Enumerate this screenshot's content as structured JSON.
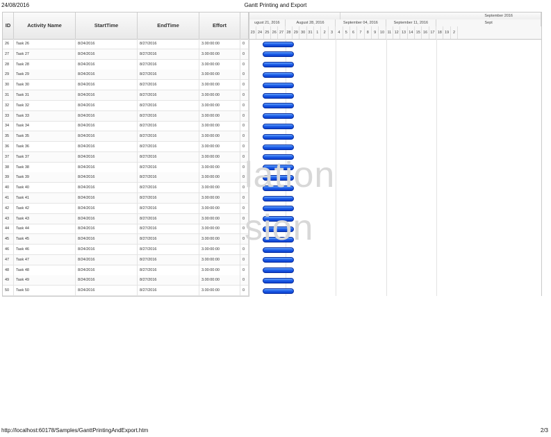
{
  "page": {
    "date": "24/08/2016",
    "title": "Gantt Printing and Export",
    "url": "http://localhost:60178/Samples/GanttPrintingAndExport.htm",
    "page_num": "2/3"
  },
  "grid": {
    "columns": [
      "ID",
      "Activity Name",
      "StartTime",
      "EndTime",
      "Effort",
      ""
    ],
    "rows": [
      {
        "id": "26",
        "name": "Task 26",
        "start": "8/24/2016",
        "end": "8/27/2016",
        "effort": "3.00:00:00",
        "x": "0"
      },
      {
        "id": "27",
        "name": "Task 27",
        "start": "8/24/2016",
        "end": "8/27/2016",
        "effort": "3.00:00:00",
        "x": "0"
      },
      {
        "id": "28",
        "name": "Task 28",
        "start": "8/24/2016",
        "end": "8/27/2016",
        "effort": "3.00:00:00",
        "x": "0"
      },
      {
        "id": "29",
        "name": "Task 29",
        "start": "8/24/2016",
        "end": "8/27/2016",
        "effort": "3.00:00:00",
        "x": "0"
      },
      {
        "id": "30",
        "name": "Task 30",
        "start": "8/24/2016",
        "end": "8/27/2016",
        "effort": "3.00:00:00",
        "x": "0"
      },
      {
        "id": "31",
        "name": "Task 31",
        "start": "8/24/2016",
        "end": "8/27/2016",
        "effort": "3.00:00:00",
        "x": "0"
      },
      {
        "id": "32",
        "name": "Task 32",
        "start": "8/24/2016",
        "end": "8/27/2016",
        "effort": "3.00:00:00",
        "x": "0"
      },
      {
        "id": "33",
        "name": "Task 33",
        "start": "8/24/2016",
        "end": "8/27/2016",
        "effort": "3.00:00:00",
        "x": "0"
      },
      {
        "id": "34",
        "name": "Task 34",
        "start": "8/24/2016",
        "end": "8/27/2016",
        "effort": "3.00:00:00",
        "x": "0"
      },
      {
        "id": "35",
        "name": "Task 35",
        "start": "8/24/2016",
        "end": "8/27/2016",
        "effort": "3.00:00:00",
        "x": "0"
      },
      {
        "id": "36",
        "name": "Task 36",
        "start": "8/24/2016",
        "end": "8/27/2016",
        "effort": "3.00:00:00",
        "x": "0"
      },
      {
        "id": "37",
        "name": "Task 37",
        "start": "8/24/2016",
        "end": "8/27/2016",
        "effort": "3.00:00:00",
        "x": "0"
      },
      {
        "id": "38",
        "name": "Task 38",
        "start": "8/24/2016",
        "end": "8/27/2016",
        "effort": "3.00:00:00",
        "x": "0"
      },
      {
        "id": "39",
        "name": "Task 39",
        "start": "8/24/2016",
        "end": "8/27/2016",
        "effort": "3.00:00:00",
        "x": "0"
      },
      {
        "id": "40",
        "name": "Task 40",
        "start": "8/24/2016",
        "end": "8/27/2016",
        "effort": "3.00:00:00",
        "x": "0"
      },
      {
        "id": "41",
        "name": "Task 41",
        "start": "8/24/2016",
        "end": "8/27/2016",
        "effort": "3.00:00:00",
        "x": "0"
      },
      {
        "id": "42",
        "name": "Task 42",
        "start": "8/24/2016",
        "end": "8/27/2016",
        "effort": "3.00:00:00",
        "x": "0"
      },
      {
        "id": "43",
        "name": "Task 43",
        "start": "8/24/2016",
        "end": "8/27/2016",
        "effort": "3.00:00:00",
        "x": "0"
      },
      {
        "id": "44",
        "name": "Task 44",
        "start": "8/24/2016",
        "end": "8/27/2016",
        "effort": "3.00:00:00",
        "x": "0"
      },
      {
        "id": "45",
        "name": "Task 45",
        "start": "8/24/2016",
        "end": "8/27/2016",
        "effort": "3.00:00:00",
        "x": "0"
      },
      {
        "id": "46",
        "name": "Task 46",
        "start": "8/24/2016",
        "end": "8/27/2016",
        "effort": "3.00:00:00",
        "x": "0"
      },
      {
        "id": "47",
        "name": "Task 47",
        "start": "8/24/2016",
        "end": "8/27/2016",
        "effort": "3.00:00:00",
        "x": "0"
      },
      {
        "id": "48",
        "name": "Task 48",
        "start": "8/24/2016",
        "end": "8/27/2016",
        "effort": "3.00:00:00",
        "x": "0"
      },
      {
        "id": "49",
        "name": "Task 49",
        "start": "8/24/2016",
        "end": "8/27/2016",
        "effort": "3.00:00:00",
        "x": "0"
      },
      {
        "id": "50",
        "name": "Task 50",
        "start": "8/24/2016",
        "end": "8/27/2016",
        "effort": "3.00:00:00",
        "x": "0"
      }
    ]
  },
  "timeline": {
    "month_label": "September 2016",
    "weeks": [
      "ugust 21, 2016",
      "August 28, 2016",
      "September 04, 2016",
      "September 11, 2016",
      "Sept"
    ],
    "days": [
      "23",
      "24",
      "25",
      "26",
      "27",
      "28",
      "29",
      "30",
      "31",
      "1",
      "2",
      "3",
      "4",
      "5",
      "6",
      "7",
      "8",
      "9",
      "10",
      "11",
      "12",
      "13",
      "14",
      "15",
      "16",
      "17",
      "18",
      "19",
      "2"
    ]
  },
  "watermark": {
    "line1": "lation",
    "line2": "sion"
  },
  "colors": {
    "bar_top": "#6aa8ff",
    "bar_bottom": "#0b3fcf"
  }
}
